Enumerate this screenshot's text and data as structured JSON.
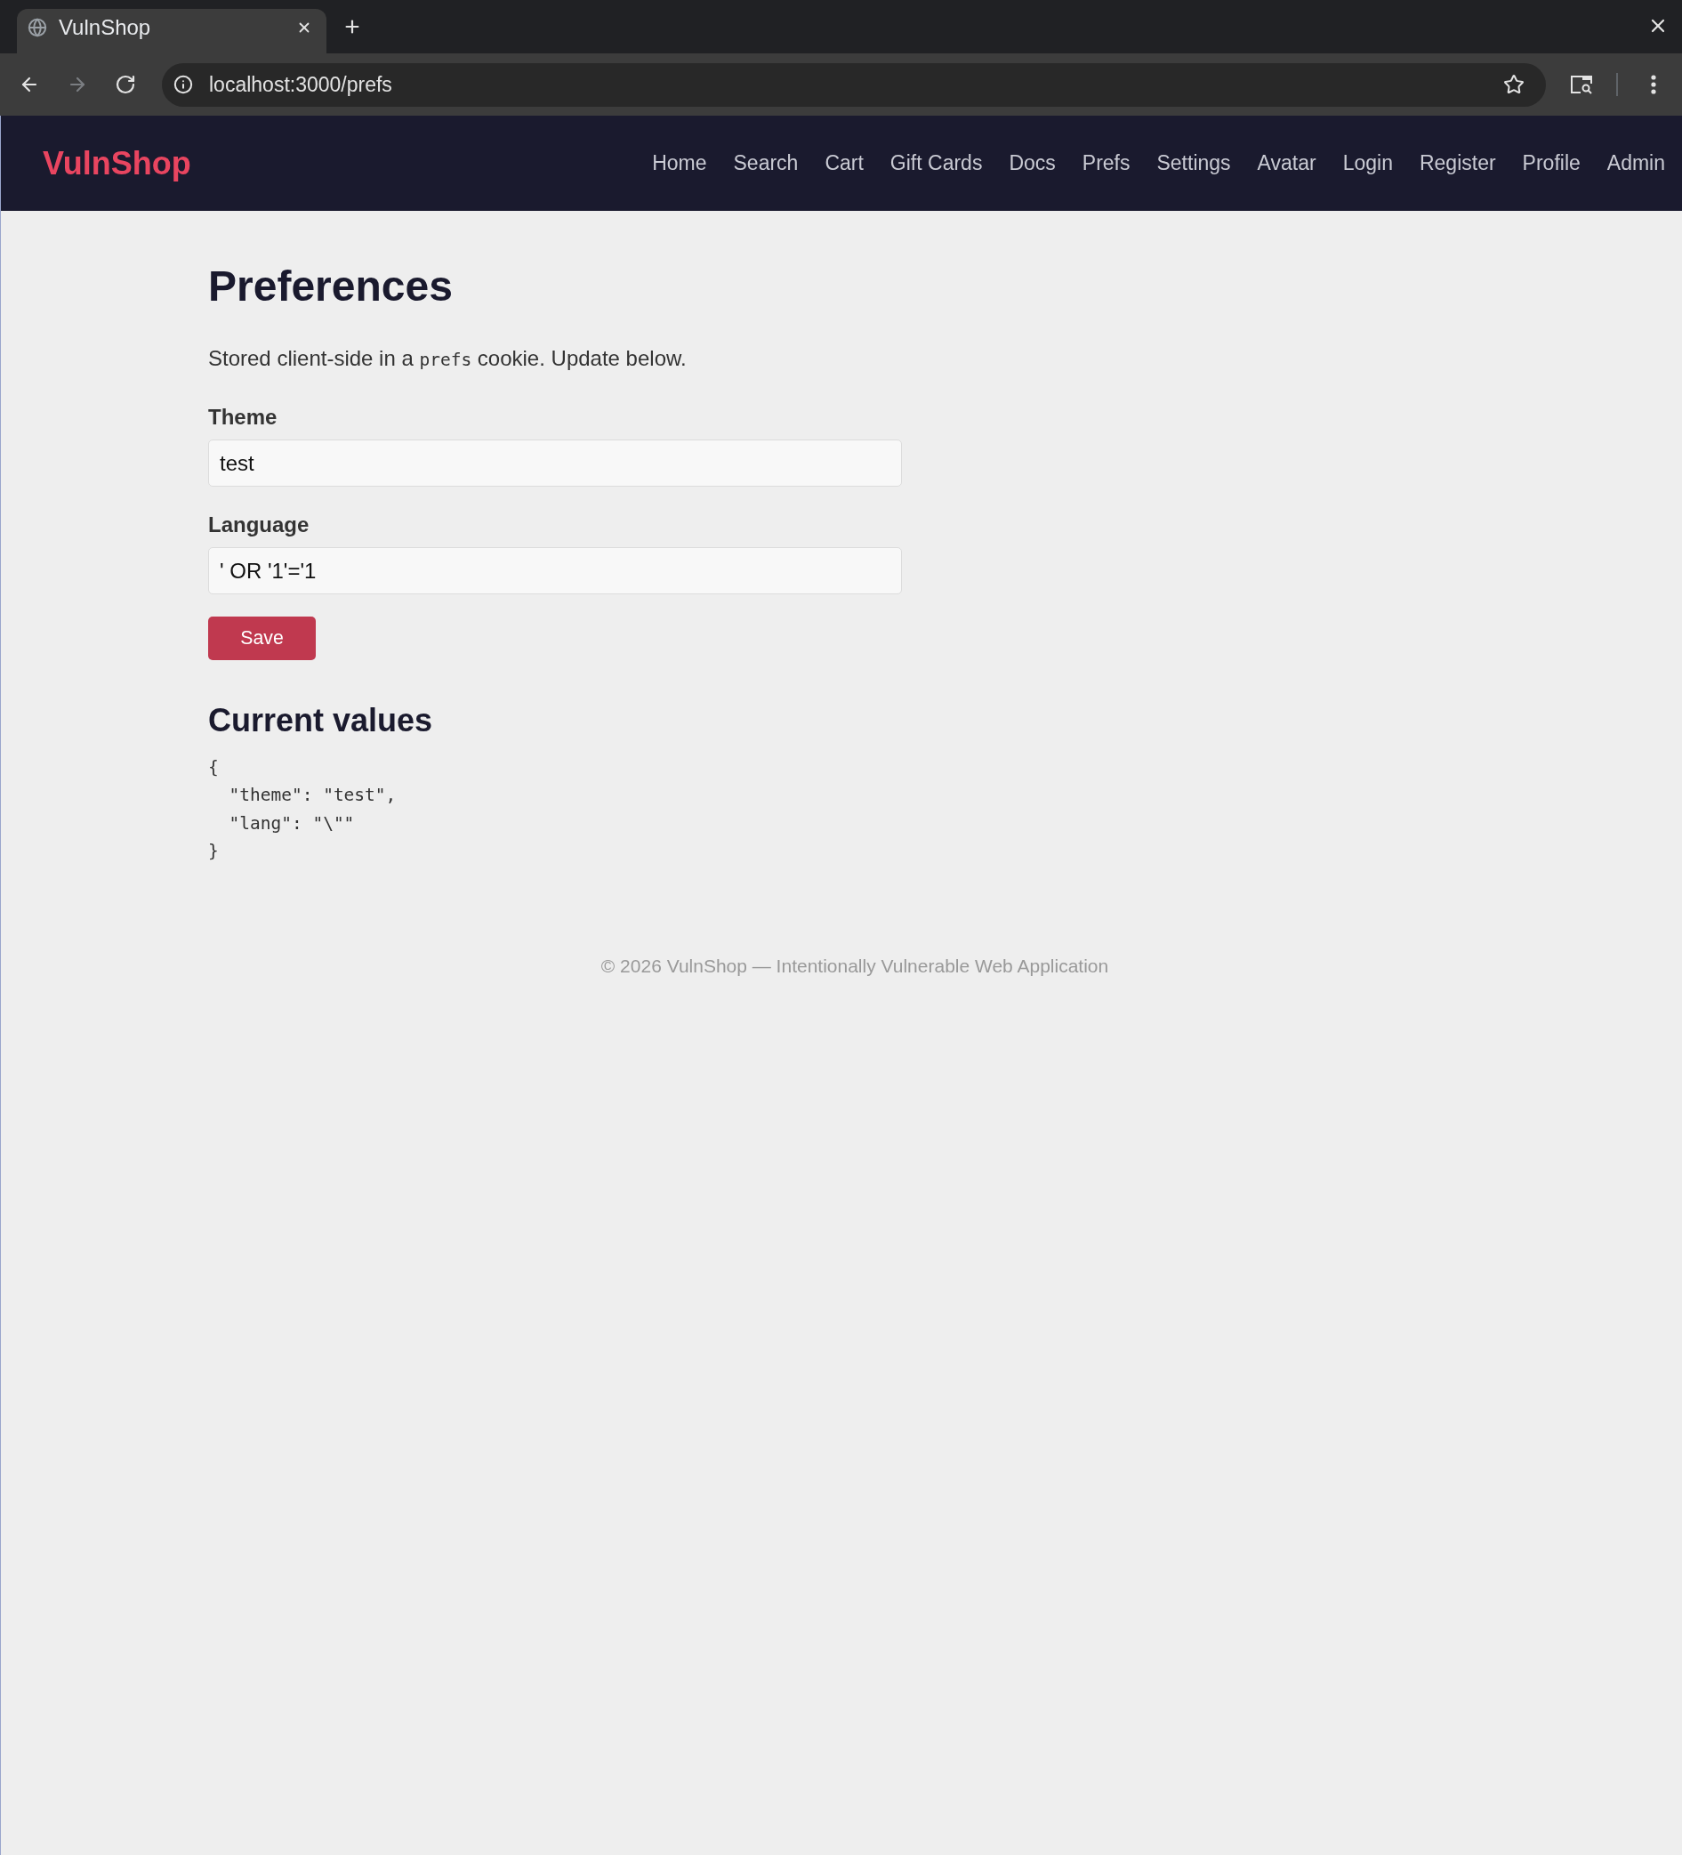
{
  "browser": {
    "tabs": [
      {
        "title": "VulnShop",
        "selected": true
      }
    ],
    "nav_buttons": [
      {
        "kind": "back",
        "disabled": false
      },
      {
        "kind": "forward",
        "disabled": true
      },
      {
        "kind": "reload",
        "disabled": false
      }
    ],
    "address": "localhost:3000/prefs"
  },
  "navbar": {
    "brand": "VulnShop",
    "links": [
      {
        "label": "Home"
      },
      {
        "label": "Search"
      },
      {
        "label": "Cart"
      },
      {
        "label": "Gift Cards"
      },
      {
        "label": "Docs"
      },
      {
        "label": "Prefs"
      },
      {
        "label": "Settings"
      },
      {
        "label": "Avatar"
      },
      {
        "label": "Login"
      },
      {
        "label": "Register"
      },
      {
        "label": "Profile"
      },
      {
        "label": "Admin"
      }
    ]
  },
  "content": {
    "title": "Preferences",
    "intro": [
      {
        "kind": "text",
        "text": "Stored client-side in a "
      },
      {
        "kind": "code",
        "text": "prefs"
      },
      {
        "kind": "text",
        "text": " cookie. Update below."
      }
    ],
    "fields": [
      {
        "label": "Theme",
        "value": "test"
      },
      {
        "label": "Language",
        "value": "' OR '1'='1"
      }
    ],
    "save_button": "Save",
    "current_values": {
      "title": "Current values",
      "code_lines": [
        "{",
        "  \"theme\": \"test\",",
        "  \"lang\": \"\\\"\"",
        "}"
      ]
    }
  },
  "footer": "© 2026 VulnShop — Intentionally Vulnerable Web Application"
}
